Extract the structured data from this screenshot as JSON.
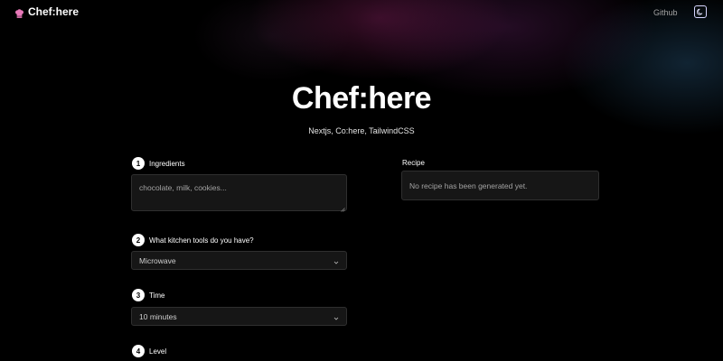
{
  "header": {
    "brand": "Chef:here",
    "brand_icon": "chef-hat-icon",
    "github_label": "Github",
    "theme_icon": "moon-icon"
  },
  "hero": {
    "title": "Chef:here",
    "subtitle": "Nextjs, Co:here, TailwindCSS"
  },
  "form": {
    "steps": [
      {
        "number": "1",
        "label": "Ingredients",
        "placeholder": "chocolate, milk, cookies..."
      },
      {
        "number": "2",
        "label": "What kitchen tools do you have?",
        "value": "Microwave"
      },
      {
        "number": "3",
        "label": "Time",
        "value": "10 minutes"
      },
      {
        "number": "4",
        "label": "Level"
      }
    ]
  },
  "recipe": {
    "label": "Recipe",
    "empty_text": "No recipe has been generated yet."
  },
  "colors": {
    "background": "#000000",
    "brand_icon": "#e879b9",
    "field_bg": "#161616",
    "field_border": "#2f2f2f"
  }
}
